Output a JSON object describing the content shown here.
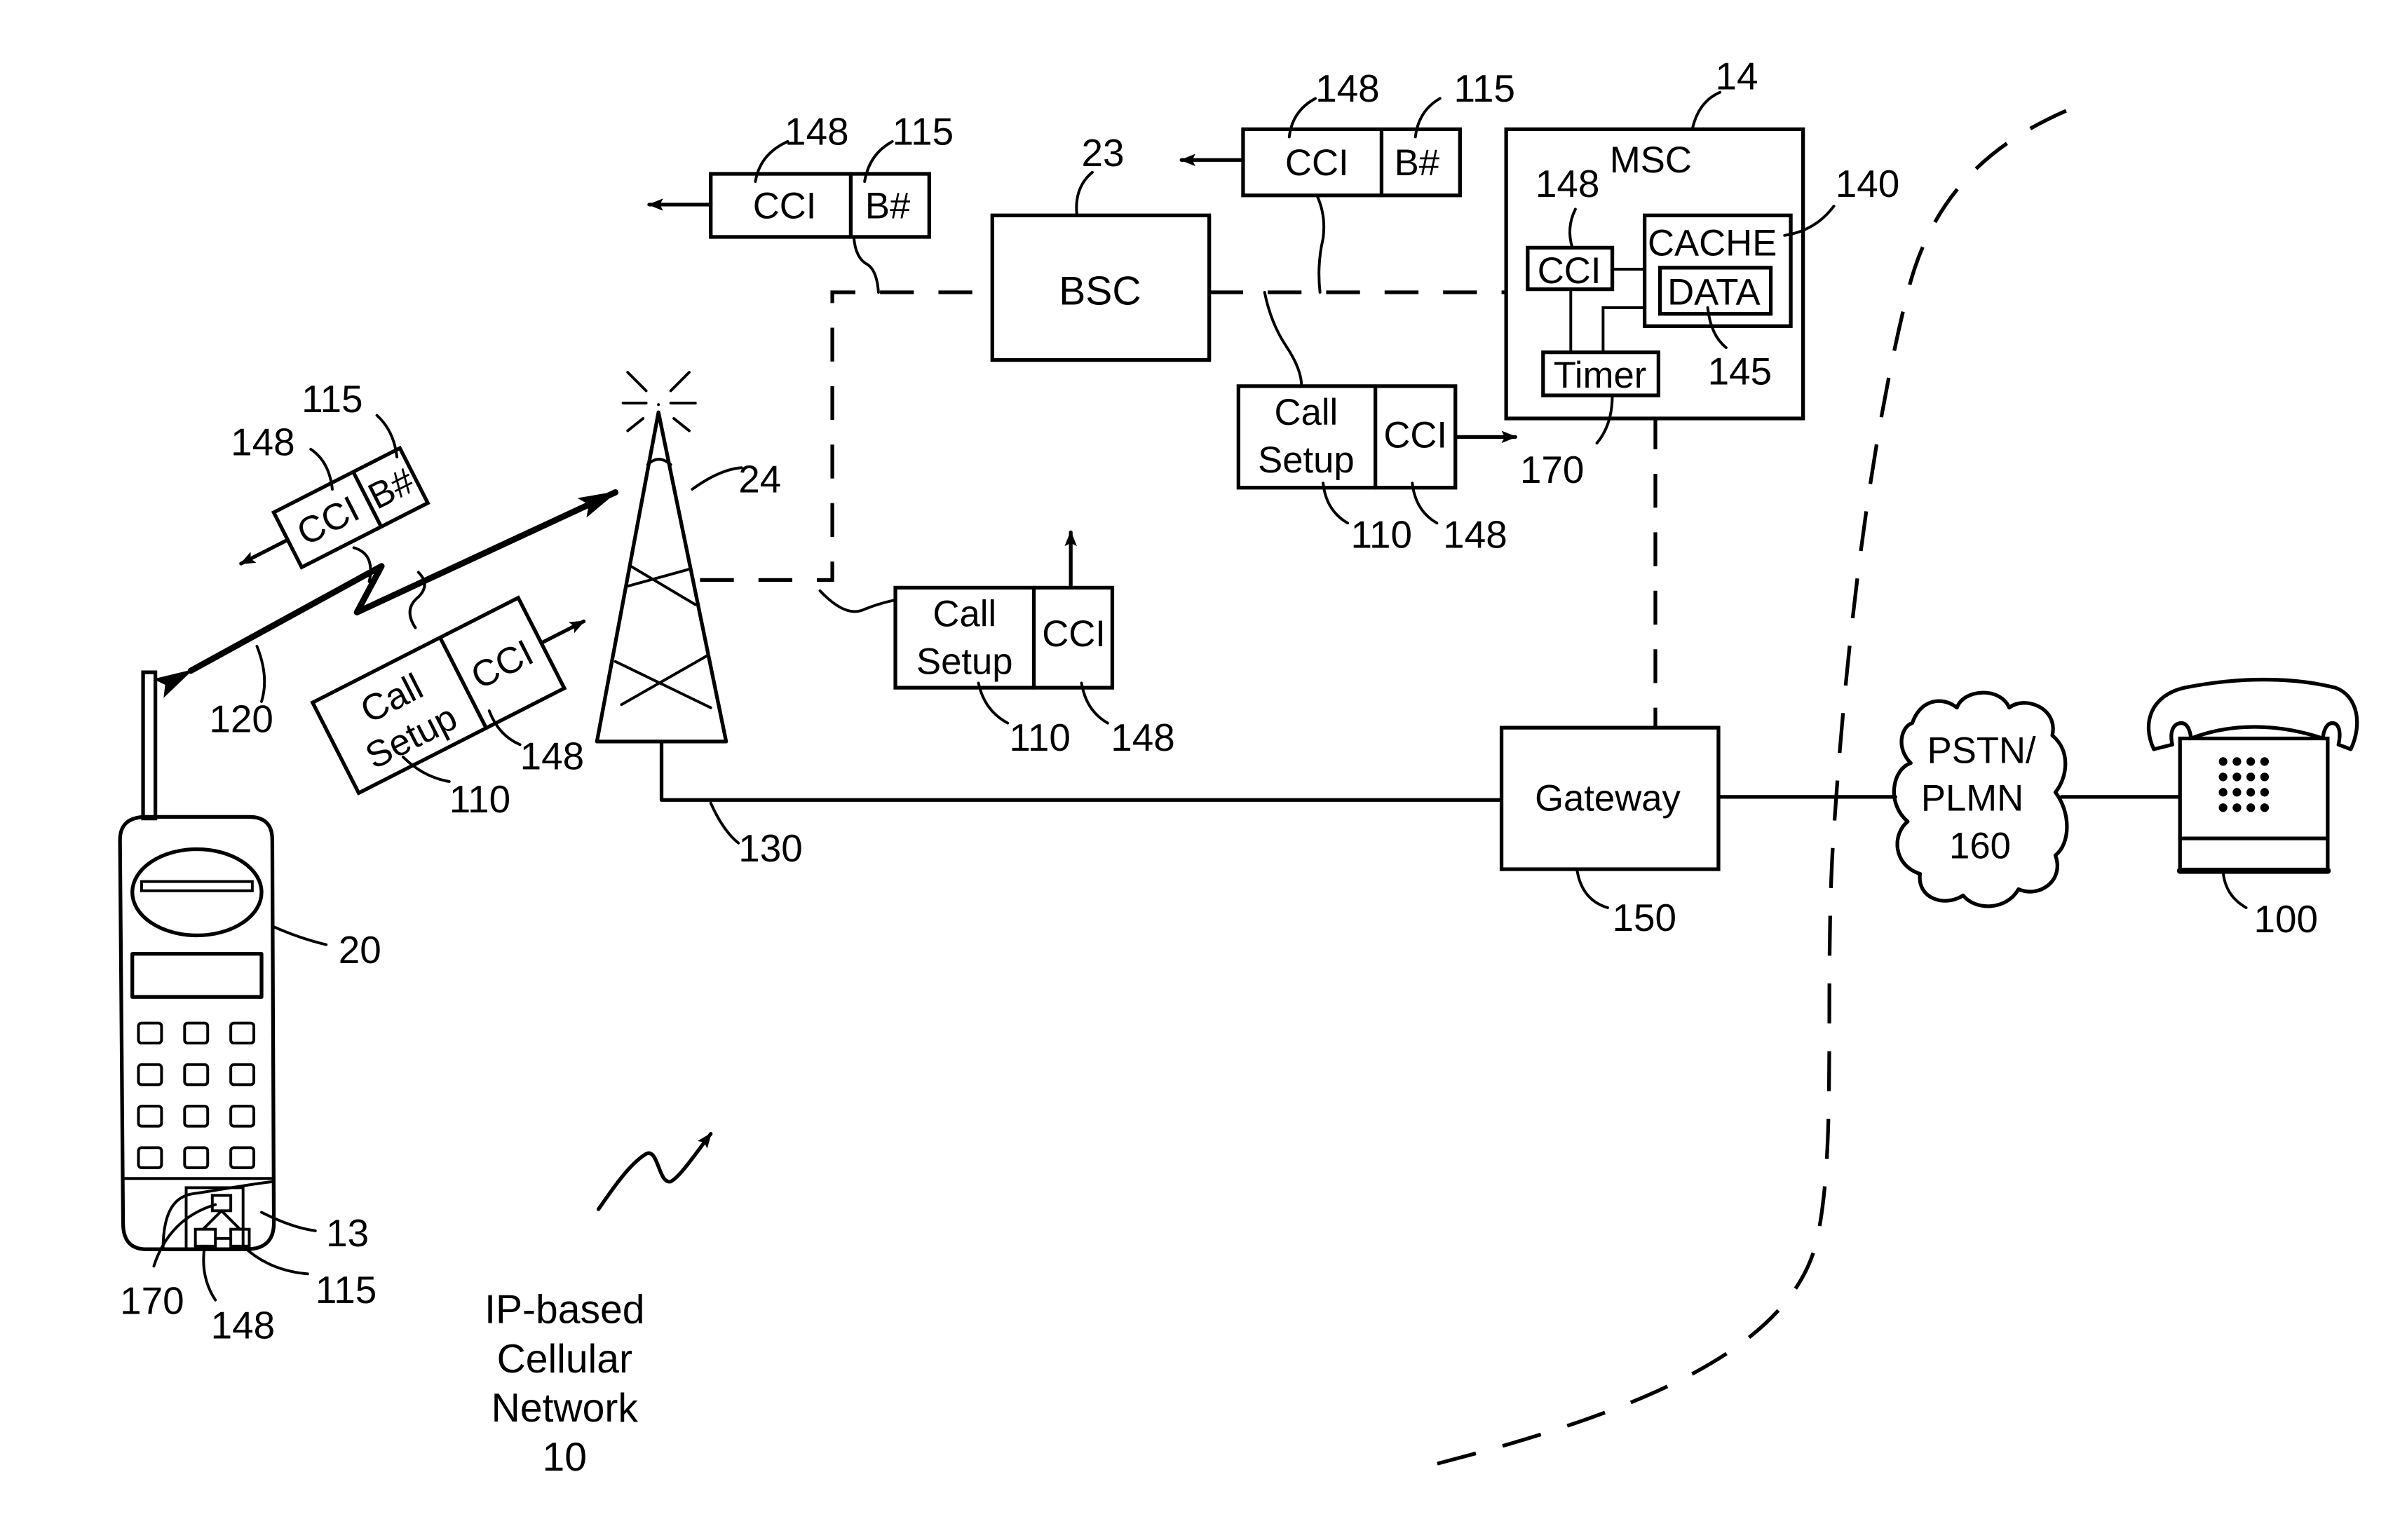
{
  "figure": {
    "network_label": {
      "line1": "IP-based",
      "line2": "Cellular",
      "line3": "Network",
      "ref": "10"
    },
    "mobile_station": {
      "ref": "20",
      "sim_ref": "13",
      "sim_parts": {
        "timer_ref": "170",
        "cci_ref": "148",
        "bnum_ref": "115"
      }
    },
    "radio_link": {
      "ref": "120"
    },
    "base_station": {
      "ref": "24"
    },
    "backhaul_link": {
      "ref": "130"
    },
    "bsc": {
      "label": "BSC",
      "ref": "23"
    },
    "msc": {
      "label": "MSC",
      "ref": "14",
      "cci": {
        "label": "CCI",
        "ref": "148"
      },
      "cache": {
        "label": "CACHE",
        "ref": "140"
      },
      "data": {
        "label": "DATA",
        "ref": "145"
      },
      "timer": {
        "label": "Timer",
        "ref": "170"
      }
    },
    "gateway": {
      "label": "Gateway",
      "ref": "150"
    },
    "pstn": {
      "line1": "PSTN/",
      "line2": "PLMN",
      "ref": "160"
    },
    "landline_phone": {
      "ref": "100"
    },
    "messages": {
      "air_cci_bnum": {
        "cci": "CCI",
        "bnum": "B#",
        "cci_ref": "148",
        "bnum_ref": "115"
      },
      "air_call_setup": {
        "setup_line1": "Call",
        "setup_line2": "Setup",
        "cci": "CCI",
        "setup_ref": "110",
        "cci_ref": "148"
      },
      "bts_call_setup": {
        "setup_line1": "Call",
        "setup_line2": "Setup",
        "cci": "CCI",
        "setup_ref": "110",
        "cci_ref": "148"
      },
      "bts_cci_bnum": {
        "cci": "CCI",
        "bnum": "B#",
        "cci_ref": "148",
        "bnum_ref": "115"
      },
      "bsc_call_setup": {
        "setup_line1": "Call",
        "setup_line2": "Setup",
        "cci": "CCI",
        "setup_ref": "110",
        "cci_ref": "148"
      },
      "bsc_cci_bnum": {
        "cci": "CCI",
        "bnum": "B#",
        "cci_ref": "148",
        "bnum_ref": "115"
      }
    }
  }
}
